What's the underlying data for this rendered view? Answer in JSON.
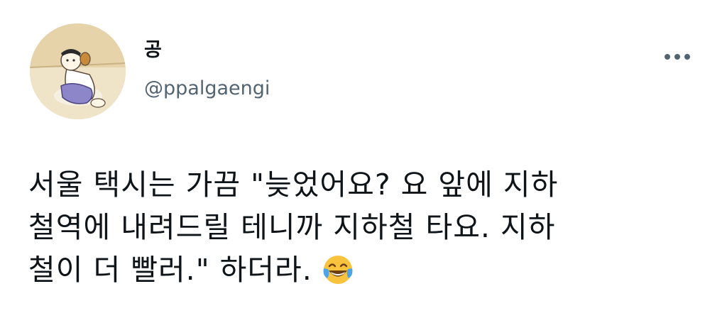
{
  "tweet": {
    "display_name": "공",
    "handle": "@ppalgaengi",
    "more_icon": "more-horizontal-icon",
    "avatar_icon": "cartoon-avatar-icon",
    "body_lines": [
      "서울 택시는 가끔 \"늦었어요? 요 앞에 지하",
      "철역에 내려드릴 테니까 지하철 타요. 지하",
      "철이 더 빨러.\" 하더라."
    ],
    "emoji": "face-with-tears-of-joy-icon"
  },
  "colors": {
    "text": "#0f1419",
    "secondary": "#536471",
    "background": "#ffffff",
    "emoji_yellow": "#f9c33d",
    "emoji_tears": "#4ea3e6"
  }
}
